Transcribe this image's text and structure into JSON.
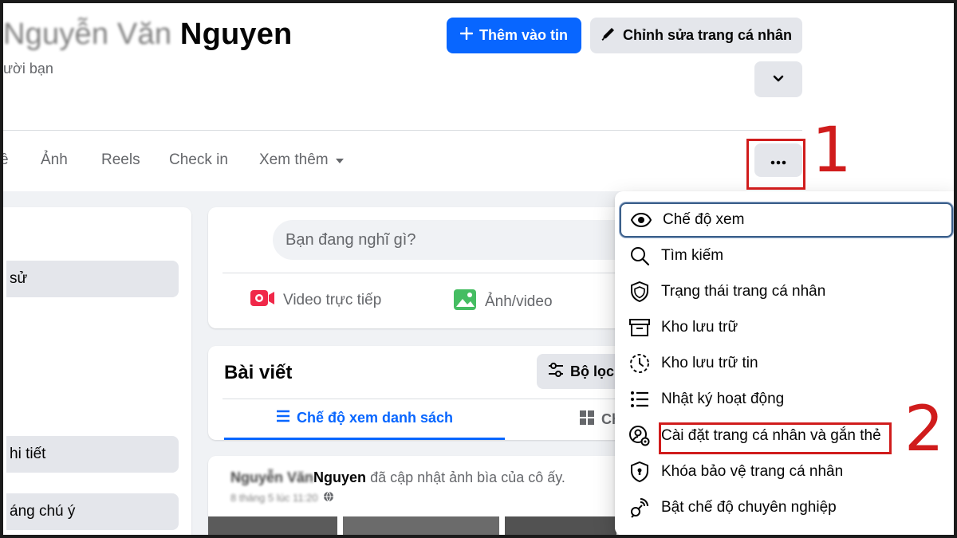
{
  "profile": {
    "name_prefix": "Nguyễn Văn",
    "name": "Nguyen",
    "friends_fragment": "ười bạn"
  },
  "actions": {
    "add_story_label": "Thêm vào tin",
    "edit_profile_label": "Chỉnh sửa trang cá nhân",
    "expand_icon": "chevron-down-icon",
    "more_icon": "ellipsis-icon",
    "accent_color": "#0866ff"
  },
  "tabs": [
    {
      "label": "ề"
    },
    {
      "label": "Ảnh"
    },
    {
      "label": "Reels"
    },
    {
      "label": "Check in"
    },
    {
      "label": "Xem thêm"
    }
  ],
  "left_sidebar": {
    "items": [
      {
        "label": "sử"
      },
      {
        "label": "hi tiết"
      },
      {
        "label": "áng chú ý"
      }
    ]
  },
  "composer": {
    "placeholder": "Bạn đang nghĩ gì?",
    "live_video_label": "Video trực tiếp",
    "photo_video_label": "Ảnh/video"
  },
  "posts": {
    "title": "Bài viết",
    "filter_label": "Bộ lọc",
    "list_view_label": "Chế độ xem danh sách",
    "grid_view_label": "Ch"
  },
  "feed": {
    "author_prefix": "Nguyễn Văn",
    "author": "Nguyen",
    "action_text": "đã cập nhật ảnh bìa của cô ấy.",
    "timestamp": "8 tháng 5 lúc 11:20"
  },
  "menu": {
    "items": [
      {
        "label": "Chế độ xem",
        "icon": "eye-icon"
      },
      {
        "label": "Tìm kiếm",
        "icon": "search-icon"
      },
      {
        "label": "Trạng thái trang cá nhân",
        "icon": "shield-icon"
      },
      {
        "label": "Kho lưu trữ",
        "icon": "archive-icon"
      },
      {
        "label": "Kho lưu trữ tin",
        "icon": "story-archive-icon"
      },
      {
        "label": "Nhật ký hoạt động",
        "icon": "list-icon"
      },
      {
        "label": "Cài đặt trang cá nhân và gắn thẻ",
        "icon": "profile-settings-icon"
      },
      {
        "label": "Khóa bảo vệ trang cá nhân",
        "icon": "lock-shield-icon"
      },
      {
        "label": "Bật chế độ chuyên nghiệp",
        "icon": "professional-icon"
      }
    ]
  },
  "annotations": {
    "step1": "1",
    "step2": "2",
    "color": "#d01c1c"
  }
}
